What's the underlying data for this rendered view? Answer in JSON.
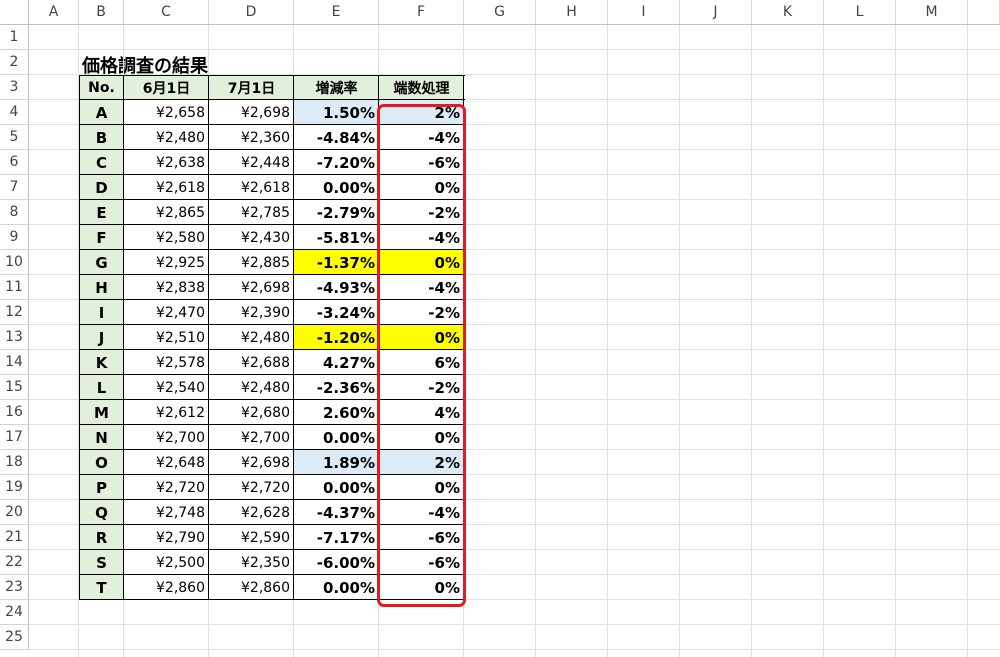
{
  "columns": [
    "A",
    "B",
    "C",
    "D",
    "E",
    "F",
    "G",
    "H",
    "I",
    "J",
    "K",
    "L",
    "M"
  ],
  "rows": [
    "1",
    "2",
    "3",
    "4",
    "5",
    "6",
    "7",
    "8",
    "9",
    "10",
    "11",
    "12",
    "13",
    "14",
    "15",
    "16",
    "17",
    "18",
    "19",
    "20",
    "21",
    "22",
    "23",
    "24",
    "25"
  ],
  "title": "価格調査の結果",
  "headers": [
    "No.",
    "6月1日",
    "7月1日",
    "増減率",
    "端数処理"
  ],
  "colors": {
    "header_fill": "#e2efda",
    "light_blue_fill": "#ddebf7",
    "yellow_fill": "#ffff00",
    "highlight_border": "#e8191e"
  },
  "table": [
    {
      "id": "A",
      "jun": "¥2,658",
      "jul": "¥2,698",
      "rate": "1.50%",
      "rounded": "2%",
      "fill": "light_blue"
    },
    {
      "id": "B",
      "jun": "¥2,480",
      "jul": "¥2,360",
      "rate": "-4.84%",
      "rounded": "-4%",
      "fill": ""
    },
    {
      "id": "C",
      "jun": "¥2,638",
      "jul": "¥2,448",
      "rate": "-7.20%",
      "rounded": "-6%",
      "fill": ""
    },
    {
      "id": "D",
      "jun": "¥2,618",
      "jul": "¥2,618",
      "rate": "0.00%",
      "rounded": "0%",
      "fill": ""
    },
    {
      "id": "E",
      "jun": "¥2,865",
      "jul": "¥2,785",
      "rate": "-2.79%",
      "rounded": "-2%",
      "fill": ""
    },
    {
      "id": "F",
      "jun": "¥2,580",
      "jul": "¥2,430",
      "rate": "-5.81%",
      "rounded": "-4%",
      "fill": ""
    },
    {
      "id": "G",
      "jun": "¥2,925",
      "jul": "¥2,885",
      "rate": "-1.37%",
      "rounded": "0%",
      "fill": "yellow"
    },
    {
      "id": "H",
      "jun": "¥2,838",
      "jul": "¥2,698",
      "rate": "-4.93%",
      "rounded": "-4%",
      "fill": ""
    },
    {
      "id": "I",
      "jun": "¥2,470",
      "jul": "¥2,390",
      "rate": "-3.24%",
      "rounded": "-2%",
      "fill": ""
    },
    {
      "id": "J",
      "jun": "¥2,510",
      "jul": "¥2,480",
      "rate": "-1.20%",
      "rounded": "0%",
      "fill": "yellow"
    },
    {
      "id": "K",
      "jun": "¥2,578",
      "jul": "¥2,688",
      "rate": "4.27%",
      "rounded": "6%",
      "fill": ""
    },
    {
      "id": "L",
      "jun": "¥2,540",
      "jul": "¥2,480",
      "rate": "-2.36%",
      "rounded": "-2%",
      "fill": ""
    },
    {
      "id": "M",
      "jun": "¥2,612",
      "jul": "¥2,680",
      "rate": "2.60%",
      "rounded": "4%",
      "fill": ""
    },
    {
      "id": "N",
      "jun": "¥2,700",
      "jul": "¥2,700",
      "rate": "0.00%",
      "rounded": "0%",
      "fill": ""
    },
    {
      "id": "O",
      "jun": "¥2,648",
      "jul": "¥2,698",
      "rate": "1.89%",
      "rounded": "2%",
      "fill": "light_blue"
    },
    {
      "id": "P",
      "jun": "¥2,720",
      "jul": "¥2,720",
      "rate": "0.00%",
      "rounded": "0%",
      "fill": ""
    },
    {
      "id": "Q",
      "jun": "¥2,748",
      "jul": "¥2,628",
      "rate": "-4.37%",
      "rounded": "-4%",
      "fill": ""
    },
    {
      "id": "R",
      "jun": "¥2,790",
      "jul": "¥2,590",
      "rate": "-7.17%",
      "rounded": "-6%",
      "fill": ""
    },
    {
      "id": "S",
      "jun": "¥2,500",
      "jul": "¥2,350",
      "rate": "-6.00%",
      "rounded": "-6%",
      "fill": ""
    },
    {
      "id": "T",
      "jun": "¥2,860",
      "jul": "¥2,860",
      "rate": "0.00%",
      "rounded": "0%",
      "fill": ""
    }
  ]
}
